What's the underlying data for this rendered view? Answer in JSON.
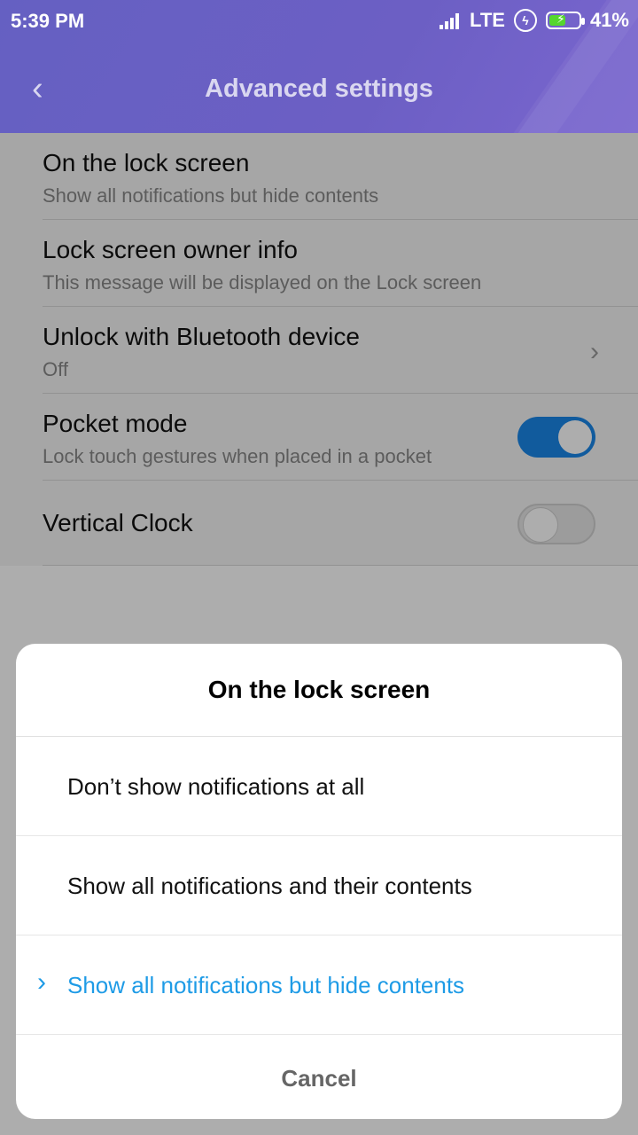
{
  "status_bar": {
    "time": "5:39 PM",
    "network": "LTE",
    "battery_percent": "41%",
    "icons": [
      "signal-icon",
      "data-saver-icon",
      "battery-charging-icon"
    ]
  },
  "header": {
    "back_icon": "chevron-left-icon",
    "title": "Advanced settings"
  },
  "settings": {
    "items": [
      {
        "label": "On the lock screen",
        "sub": "Show all notifications but hide contents"
      },
      {
        "label": "Lock screen owner info",
        "sub": "This message will be displayed on the Lock screen"
      },
      {
        "label": "Unlock with Bluetooth device",
        "sub": "Off",
        "chevron": "chevron-right-icon"
      },
      {
        "label": "Pocket mode",
        "sub": "Lock touch gestures when placed in a pocket",
        "toggle": true
      },
      {
        "label": "Vertical Clock",
        "toggle": false
      }
    ]
  },
  "dialog": {
    "title": "On the lock screen",
    "options": [
      {
        "label": "Don’t show notifications at all",
        "selected": false
      },
      {
        "label": "Show all notifications and their contents",
        "selected": false
      },
      {
        "label": "Show all notifications but hide contents",
        "selected": true
      }
    ],
    "cancel_label": "Cancel"
  },
  "colors": {
    "header_purple": "#6860c3",
    "accent_blue": "#1a86e8",
    "selected_option": "#1e9be6"
  }
}
